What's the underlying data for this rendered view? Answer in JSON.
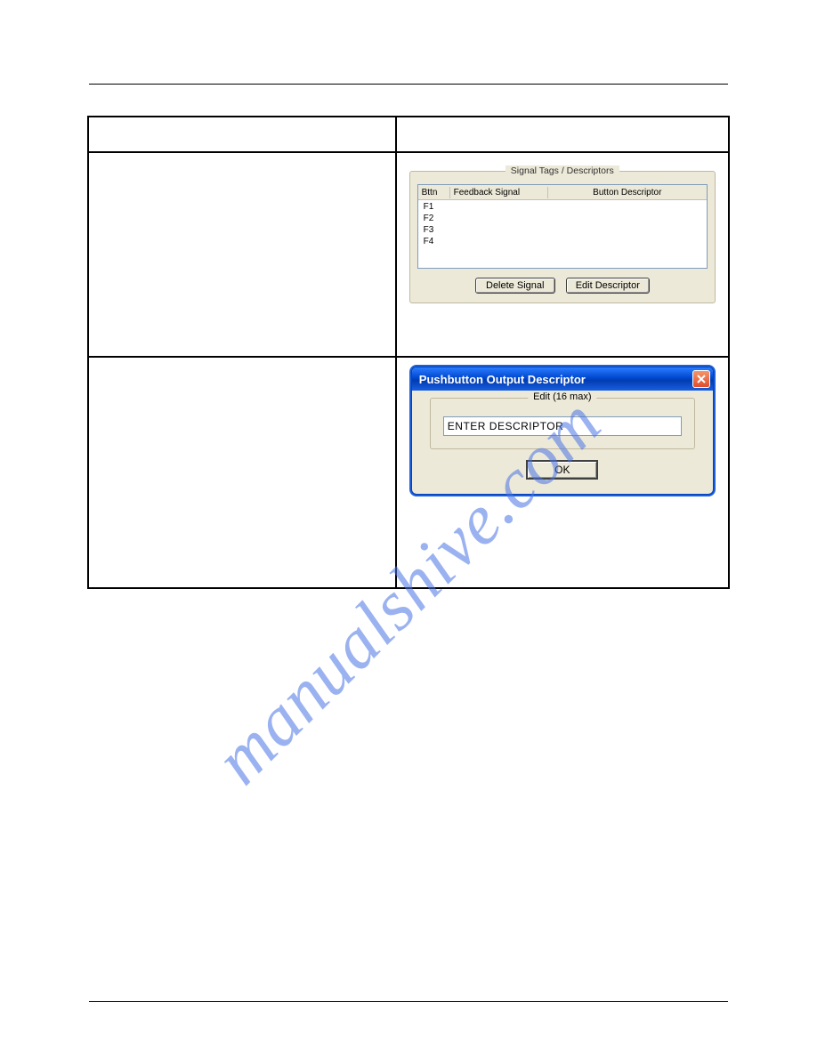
{
  "watermark": "manualshive.com",
  "group1": {
    "title": "Signal Tags / Descriptors",
    "columns": {
      "bttn": "Bttn",
      "feedback": "Feedback Signal",
      "descriptor": "Button Descriptor"
    },
    "rows": [
      "F1",
      "F2",
      "F3",
      "F4"
    ],
    "deleteBtn": "Delete Signal",
    "editBtn": "Edit Descriptor"
  },
  "dialog": {
    "title": "Pushbutton Output Descriptor",
    "groupTitle": "Edit (16 max)",
    "inputValue": "ENTER DESCRIPTOR",
    "ok": "OK"
  }
}
